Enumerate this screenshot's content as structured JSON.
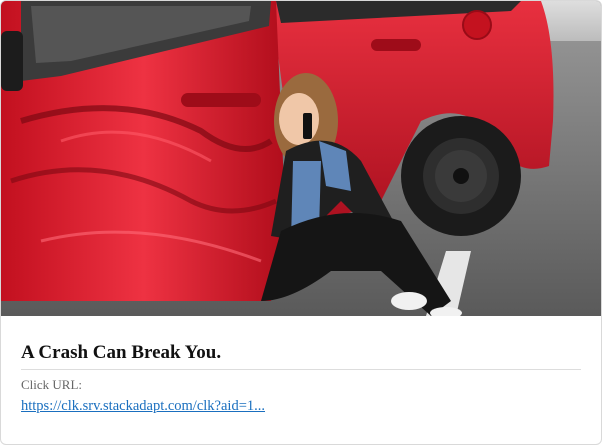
{
  "ad": {
    "image_alt": "Woman on phone sitting next to damaged red car",
    "title": "A Crash Can Break You.",
    "click_label": "Click URL:",
    "click_url": "https://clk.srv.stackadapt.com/clk?aid=1..."
  },
  "colors": {
    "title": "#111111",
    "label": "#666666",
    "link": "#1a6fbf",
    "car_red": "#d9162b",
    "road": "#6e6e6e"
  }
}
